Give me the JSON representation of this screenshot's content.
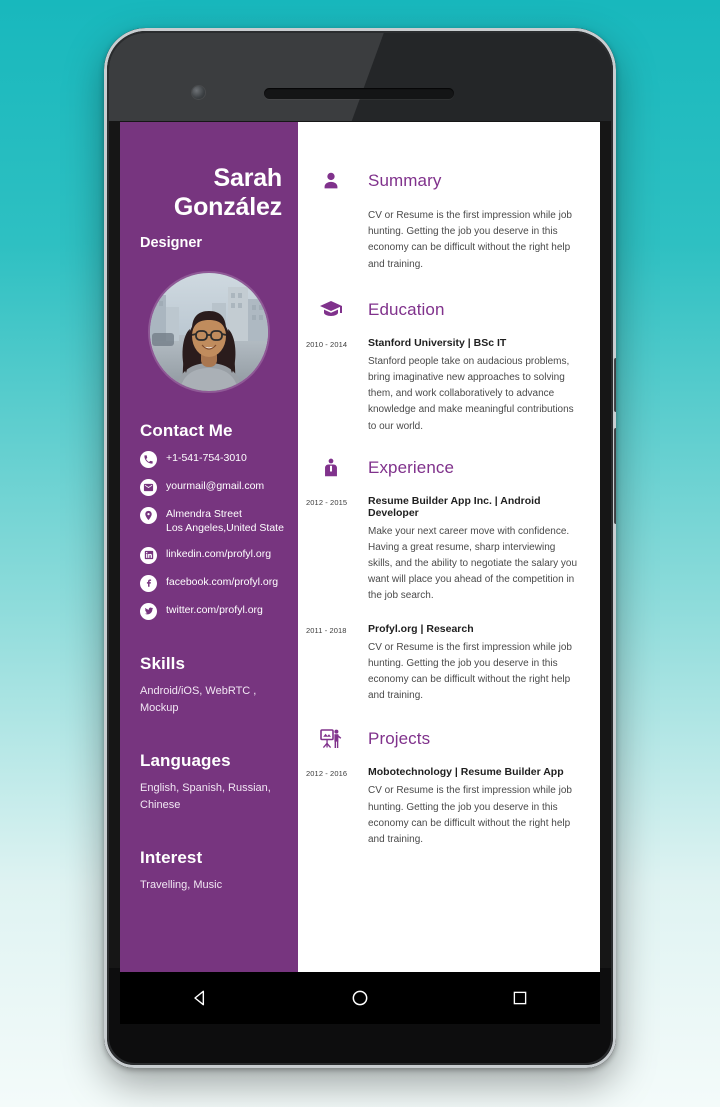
{
  "device": {
    "type": "android-phone",
    "navbar": {
      "back_label": "Back",
      "home_label": "Home",
      "recents_label": "Recent apps"
    }
  },
  "resume": {
    "sidebar": {
      "first_name": "Sarah",
      "last_name": "González",
      "role": "Designer",
      "avatar_alt": "Portrait photo of a smiling woman with glasses on a city street",
      "contact_heading": "Contact Me",
      "contacts": [
        {
          "icon": "phone-icon",
          "text": "+1-541-754-3010"
        },
        {
          "icon": "email-icon",
          "text": "yourmail@gmail.com"
        },
        {
          "icon": "location-icon",
          "text": "Almendra Street\nLos Angeles,United State",
          "line1": "Almendra Street",
          "line2": "Los Angeles,United State"
        },
        {
          "icon": "linkedin-icon",
          "text": "linkedin.com/profyl.org"
        },
        {
          "icon": "facebook-icon",
          "text": "facebook.com/profyl.org"
        },
        {
          "icon": "twitter-icon",
          "text": "twitter.com/profyl.org"
        }
      ],
      "skills_heading": "Skills",
      "skills_text": "Android/iOS, WebRTC , Mockup",
      "languages_heading": "Languages",
      "languages_text": "English, Spanish, Russian, Chinese",
      "interest_heading": "Interest",
      "interest_text": "Travelling, Music"
    },
    "sections": {
      "summary": {
        "icon": "person-icon",
        "title": "Summary",
        "description": "CV or Resume is the first impression while job hunting. Getting the job you deserve in this economy can be difficult without the right help and training."
      },
      "education": {
        "icon": "graduation-cap-icon",
        "title": "Education",
        "entries": [
          {
            "date": "2010 - 2014",
            "title": "Stanford University | BSc IT",
            "description": "Stanford people take on audacious problems, bring imaginative new approaches to solving them, and work collaboratively to advance knowledge and make meaningful contributions to our world."
          }
        ]
      },
      "experience": {
        "icon": "briefcase-person-icon",
        "title": "Experience",
        "entries": [
          {
            "date": "2012 - 2015",
            "title": "Resume Builder App Inc. | Android Developer",
            "description": "Make your next career move with confidence. Having a great resume, sharp interviewing skills, and the ability to negotiate the salary you want will place you ahead of the competition in the job search."
          },
          {
            "date": "2011 - 2018",
            "title": "Profyl.org | Research",
            "description": "CV or Resume is the first impression while job hunting. Getting the job you deserve in this economy can be difficult without the right help and training."
          }
        ]
      },
      "projects": {
        "icon": "presentation-icon",
        "title": "Projects",
        "entries": [
          {
            "date": "2012 - 2016",
            "title": "Mobotechnology | Resume Builder App",
            "description": "CV or Resume is the first impression while job hunting. Getting the job you deserve in this economy can be difficult without the right help and training."
          }
        ]
      }
    }
  },
  "colors": {
    "sidebar_purple": "#77357f",
    "heading_purple": "#80328c",
    "background_teal": "#2ec0c2",
    "content_white": "#ffffff",
    "navbar_black": "#000000"
  }
}
